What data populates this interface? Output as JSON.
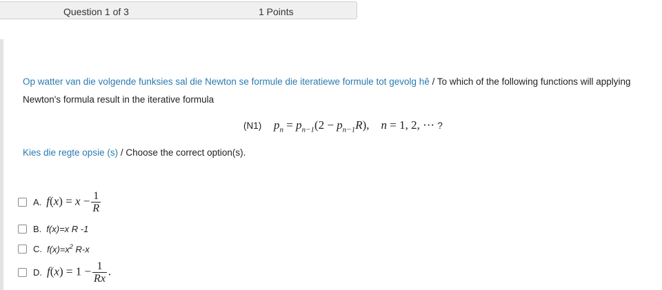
{
  "header": {
    "question_label": "Question 1 of 3",
    "points_label": "1 Points"
  },
  "question": {
    "prompt_afrikaans": "Op watter van die volgende funksies sal die Newton se formule die iteratiewe formule tot gevolg hê",
    "prompt_separator": " / ",
    "prompt_english_line1": "To which of the following functions will applying",
    "prompt_english_line2": "Newton's formula result in the iterative formula",
    "equation_label": "(N1)",
    "equation_tail": "?",
    "instruction_afrikaans": "Kies die regte opsie (s)",
    "instruction_separator": " / ",
    "instruction_english": "Choose the correct option(s)."
  },
  "options": [
    {
      "letter": "A.",
      "checked": false
    },
    {
      "letter": "B.",
      "text": "f(x)=x R -1",
      "checked": false
    },
    {
      "letter": "C.",
      "text_before_sup": "f(x)=x",
      "sup": "2",
      "text_after_sup": " R-x",
      "checked": false
    },
    {
      "letter": "D.",
      "checked": false
    }
  ],
  "colors": {
    "afrikaans_text": "#2a7ab0",
    "header_bg": "#f0f0f0"
  }
}
